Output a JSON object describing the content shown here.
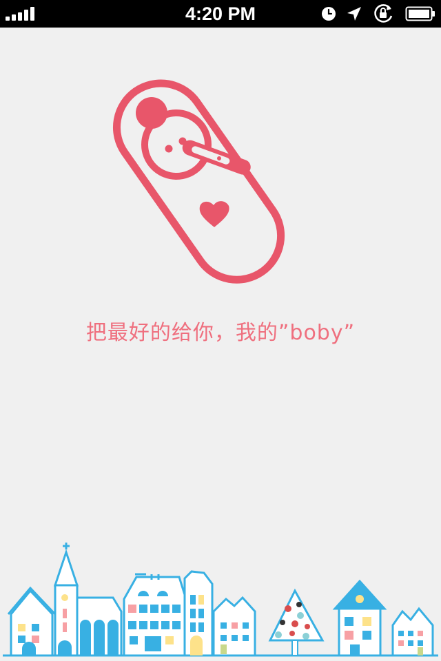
{
  "status_bar": {
    "time": "4:20 PM",
    "signal_icon": "signal-bars-icon",
    "alarm_icon": "clock-icon",
    "location_icon": "location-arrow-icon",
    "rotation_lock_icon": "rotation-lock-icon",
    "battery_icon": "battery-icon"
  },
  "splash": {
    "logo_icon": "swaddled-baby-icon",
    "slogan": "把最好的给你，我的”boby”",
    "footer_art": "town-skyline-illustration"
  },
  "colors": {
    "background": "#f0f0f0",
    "brand_pink": "#e8566a",
    "slogan_pink": "#ef6f7e",
    "town_blue": "#38b0e3"
  }
}
